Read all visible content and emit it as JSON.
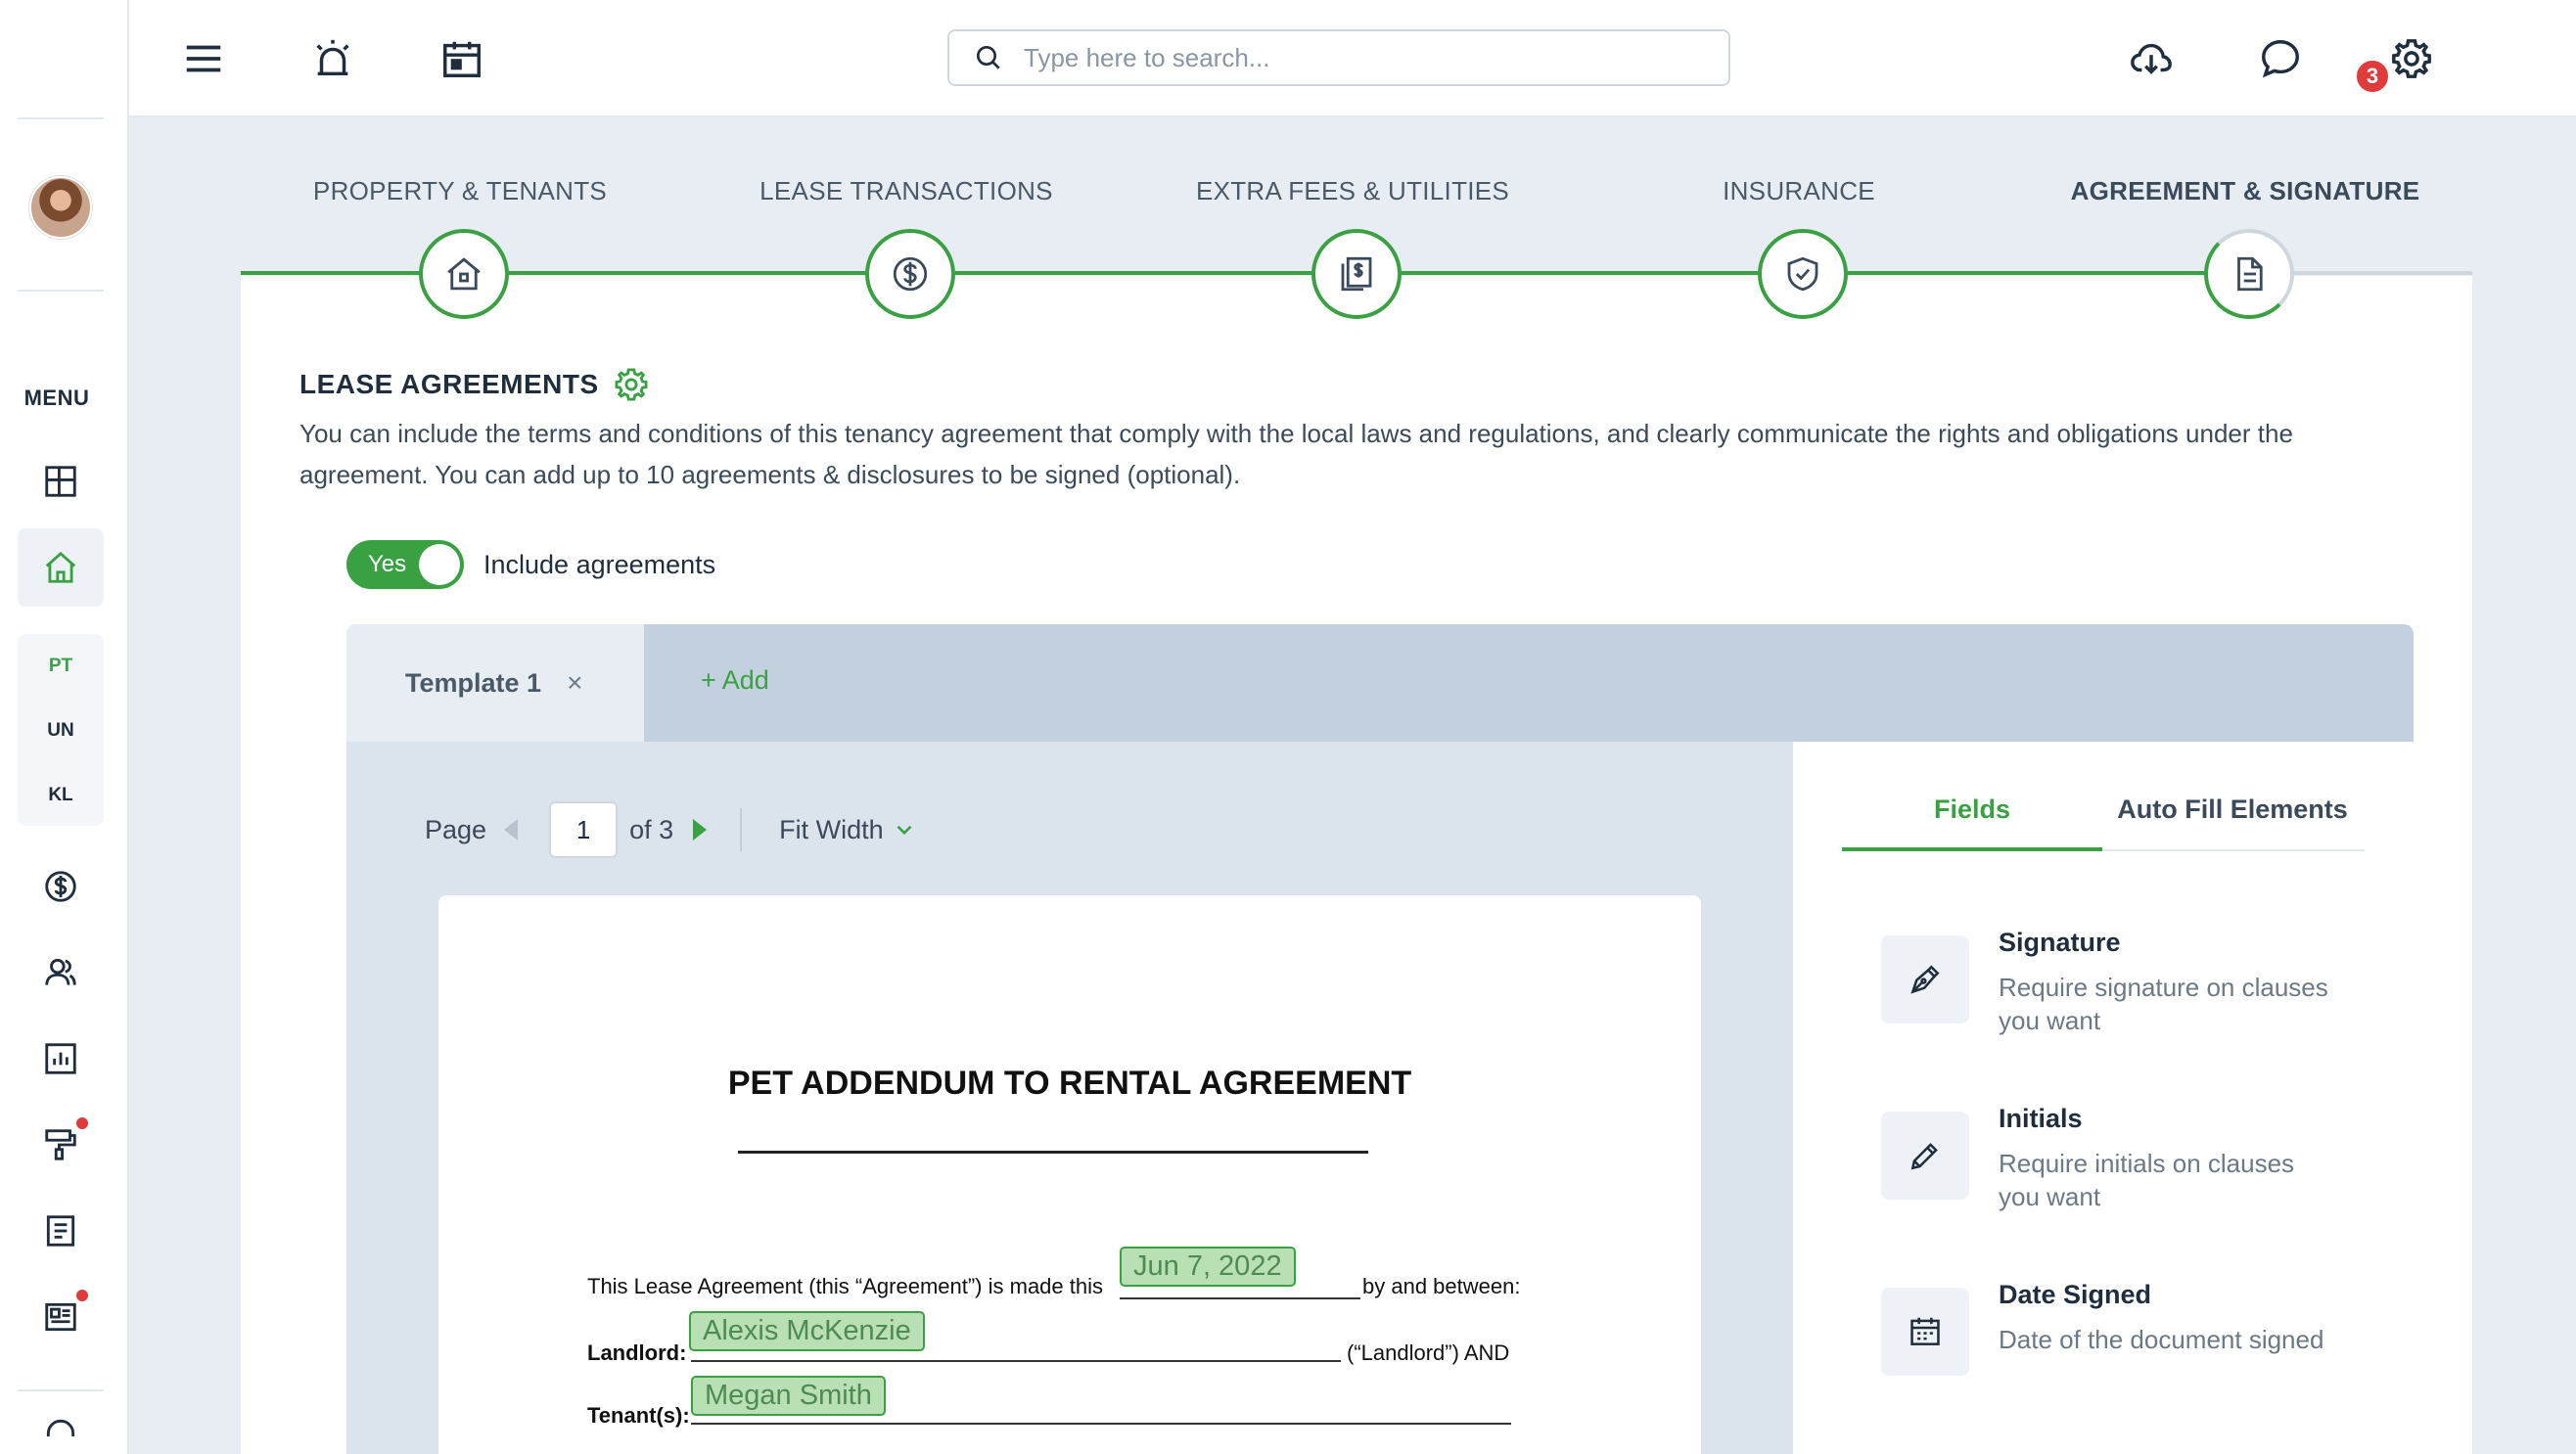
{
  "search": {
    "placeholder": "Type here to search..."
  },
  "notifications": {
    "count": "3"
  },
  "sidebar": {
    "menu_label": "MENU",
    "sub_items": [
      "PT",
      "UN",
      "KL"
    ]
  },
  "steps": [
    {
      "label": "PROPERTY & TENANTS",
      "icon": "home-icon"
    },
    {
      "label": "LEASE TRANSACTIONS",
      "icon": "dollar-icon"
    },
    {
      "label": "EXTRA FEES & UTILITIES",
      "icon": "bills-icon"
    },
    {
      "label": "INSURANCE",
      "icon": "shield-icon"
    },
    {
      "label": "AGREEMENT & SIGNATURE",
      "icon": "document-icon"
    }
  ],
  "section": {
    "title": "LEASE AGREEMENTS",
    "description": "You can include the terms and conditions of this tenancy agreement that comply with the local laws and regulations, and clearly communicate the rights and obligations under the agreement. You can add up to 10 agreements & disclosures to be signed (optional)."
  },
  "toggle": {
    "value": "Yes",
    "label": "Include agreements"
  },
  "tabs": {
    "active": "Template 1",
    "close": "×",
    "add": "+ Add"
  },
  "pager": {
    "page_label": "Page",
    "current": "1",
    "of_label": "of 3",
    "zoom": "Fit Width"
  },
  "document": {
    "title": "PET ADDENDUM TO RENTAL AGREEMENT",
    "line1_prefix": "This Lease Agreement (this “Agreement”) is made this",
    "line1_suffix": "by and between:",
    "date_field": "Jun 7, 2022",
    "landlord_label": "Landlord:",
    "landlord_field": "Alexis McKenzie",
    "landlord_suffix": "(“Landlord”) AND",
    "tenant_label": "Tenant(s):",
    "tenant_field": "Megan Smith"
  },
  "right_panel": {
    "tabs": [
      "Fields",
      "Auto Fill Elements"
    ],
    "fields": [
      {
        "title": "Signature",
        "desc": "Require signature on clauses you want",
        "icon": "pen-nib-icon"
      },
      {
        "title": "Initials",
        "desc": "Require initials on clauses you want",
        "icon": "pencil-icon"
      },
      {
        "title": "Date Signed",
        "desc": "Date of the document signed",
        "icon": "calendar-icon"
      }
    ]
  },
  "colors": {
    "accent": "#3aa143",
    "badge": "#e03b3b",
    "text": "#1f2d3d"
  }
}
